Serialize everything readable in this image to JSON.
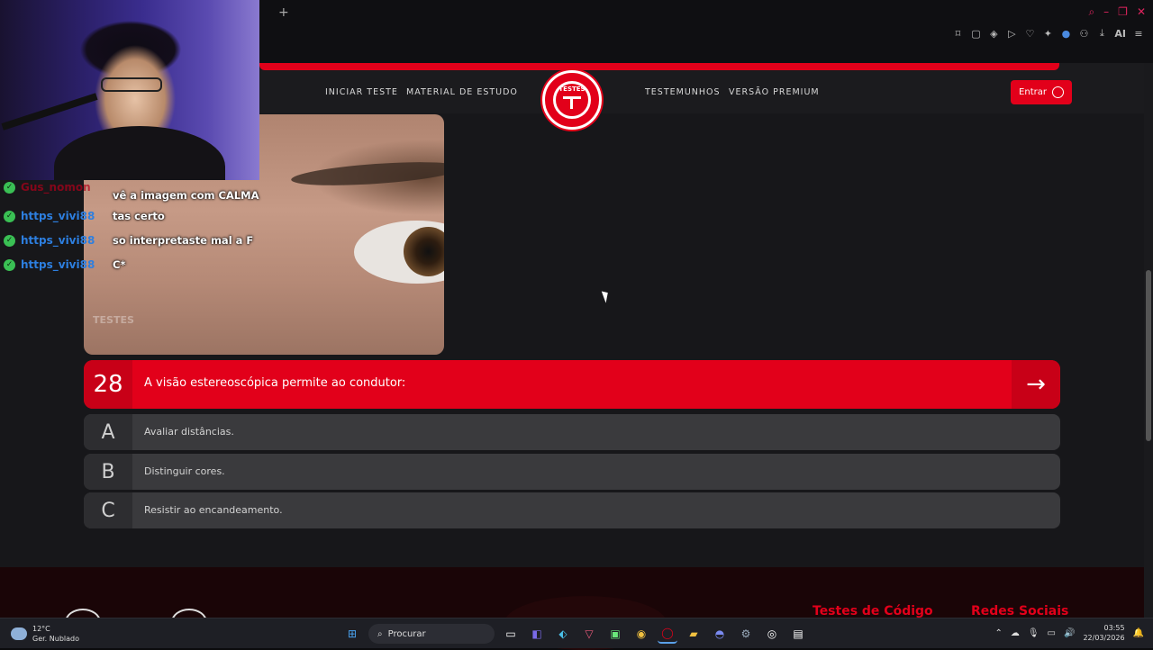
{
  "browser": {
    "new_tab_symbol": "+",
    "window_controls": [
      "⌕",
      "–",
      "❐",
      "✕"
    ],
    "toolbar_icons": [
      "pin-icon",
      "screenshot-icon",
      "pocket-icon",
      "play-icon",
      "heart-icon",
      "extensions-icon",
      "cube-icon",
      "user-icon",
      "download-icon",
      "aria-icon",
      "menu-icon"
    ],
    "ai_label": "AI"
  },
  "nav": {
    "links": [
      "INICIAR TESTE",
      "MATERIAL DE ESTUDO",
      "TESTEMUNHOS",
      "VERSÃO PREMIUM"
    ],
    "logo_text": "TESTES",
    "login_label": "Entrar"
  },
  "question": {
    "number": "28",
    "text": "A visão estereoscópica permite ao condutor:",
    "next_symbol": "→",
    "image_watermark": "TESTES"
  },
  "answers": [
    {
      "letter": "A",
      "text": "Avaliar distâncias."
    },
    {
      "letter": "B",
      "text": "Distinguir cores."
    },
    {
      "letter": "C",
      "text": "Resistir ao encandeamento."
    }
  ],
  "footer": {
    "col1_title": "Testes de Código",
    "col2_title": "Redes Sociais"
  },
  "chat": {
    "messages": [
      {
        "user": "Gus_nomon",
        "text": "vê a imagem com CALMA"
      },
      {
        "user": "https_vivi88",
        "text": "tas certo"
      },
      {
        "user": "https_vivi88",
        "text": "so interpretaste mal a F"
      },
      {
        "user": "https_vivi88",
        "text": "C*"
      }
    ]
  },
  "taskbar": {
    "temperature": "12°C",
    "weather": "Ger. Nublado",
    "search_placeholder": "Procurar",
    "time": "03:55",
    "date": "22/03/2026"
  },
  "colors": {
    "brand_red": "#e2001a",
    "dark_bg": "#17171a",
    "answer_bg": "#3a3a3d"
  }
}
